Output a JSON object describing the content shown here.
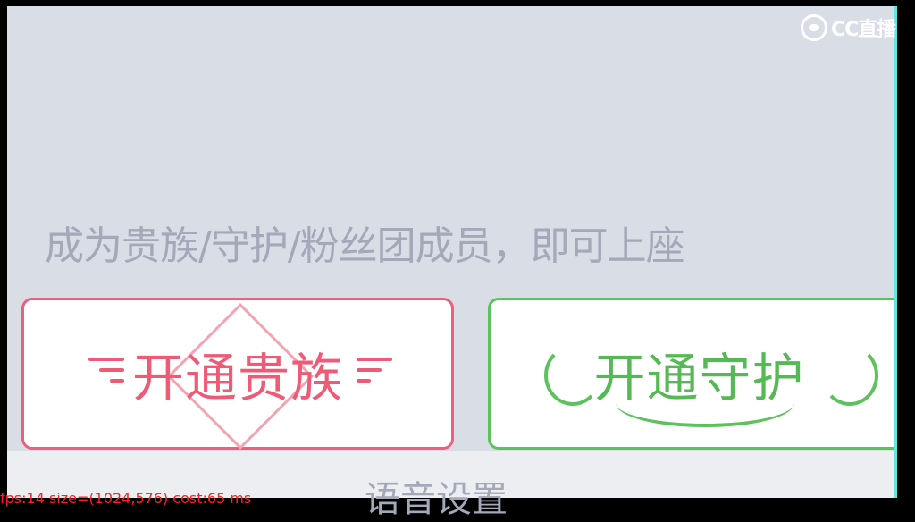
{
  "logo": {
    "text": "CC直播"
  },
  "hint_text": "成为贵族/守护/粉丝团成员，即可上座",
  "buttons": {
    "noble": {
      "label": "开通贵族",
      "color": "#ef5b76"
    },
    "guard": {
      "label": "开通守护",
      "color": "#55ba55"
    }
  },
  "bottom_text": "语音设置",
  "debug_overlay": "fps:14 size=(1024,576) cost:65 ms"
}
